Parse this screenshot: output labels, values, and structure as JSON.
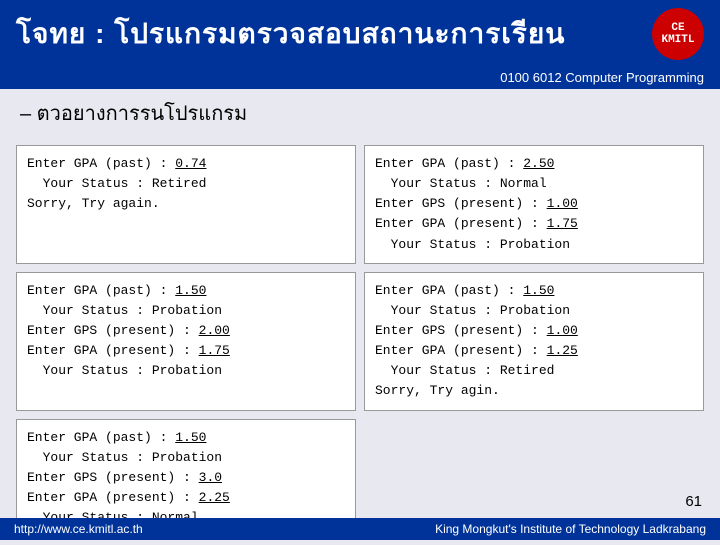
{
  "header": {
    "title": "โจทย  : โปรแกรมตรวจสอบสถานะการเรียน",
    "course": "0100 6012 Computer Programming",
    "logo_text": "CE\nKMITL"
  },
  "section": {
    "title": "–  ตวอยางการรนโปรแกรม"
  },
  "boxes": [
    {
      "id": "box1",
      "lines": [
        {
          "text": "Enter GPA (past) : ",
          "value": "0.74",
          "underline": true
        },
        {
          "text": "  Your Status : Retired",
          "value": "",
          "underline": false
        },
        {
          "text": "Sorry, Try again.",
          "value": "",
          "underline": false
        }
      ]
    },
    {
      "id": "box2",
      "lines": [
        {
          "text": "Enter GPA (past) : ",
          "value": "2.50",
          "underline": true
        },
        {
          "text": "  Your Status : Normal",
          "value": "",
          "underline": false
        },
        {
          "text": "Enter GPS (present) : ",
          "value": "1.00",
          "underline": true,
          "prefix": "Enter GPS (present) : "
        },
        {
          "text": "Enter GPA (present) : ",
          "value": "1.75",
          "underline": true,
          "prefix": "Enter GPA (present) : "
        },
        {
          "text": "  Your Status : Probation",
          "value": "",
          "underline": false
        }
      ]
    },
    {
      "id": "box3",
      "lines": [
        {
          "text": "Enter GPA (past) : ",
          "value": "1.50",
          "underline": true
        },
        {
          "text": "  Your Status : Probation",
          "value": "",
          "underline": false
        },
        {
          "text": "Enter GPS (present) : ",
          "value": "2.00",
          "underline": true
        },
        {
          "text": "Enter GPA (present) : ",
          "value": "1.75",
          "underline": true
        },
        {
          "text": "  Your Status : Probation",
          "value": "",
          "underline": false
        }
      ]
    },
    {
      "id": "box4",
      "lines": [
        {
          "text": "Enter GPA (past) : ",
          "value": "1.50",
          "underline": true
        },
        {
          "text": "  Your Status : Probation",
          "value": "",
          "underline": false
        },
        {
          "text": "Enter GPS (present) : ",
          "value": "1.00",
          "underline": true
        },
        {
          "text": "Enter GPA (present) : ",
          "value": "1.25",
          "underline": true
        },
        {
          "text": "  Your Status : Retired",
          "value": "",
          "underline": false
        },
        {
          "text": "Sorry, Try agin.",
          "value": "",
          "underline": false
        }
      ]
    },
    {
      "id": "box5",
      "lines": [
        {
          "text": "Enter GPA (past) : ",
          "value": "1.50",
          "underline": true
        },
        {
          "text": "  Your Status : Probation",
          "value": "",
          "underline": false
        },
        {
          "text": "Enter GPS (present) : ",
          "value": "3.0",
          "underline": true
        },
        {
          "text": "Enter GPA (present) : ",
          "value": "2.25",
          "underline": true
        },
        {
          "text": "  Your Status : Normal",
          "value": "",
          "underline": false
        }
      ]
    }
  ],
  "footer": {
    "left": "http://www.ce.kmitl.ac.th",
    "right": "King Mongkut's Institute of Technology Ladkrabang"
  },
  "page_number": "61"
}
